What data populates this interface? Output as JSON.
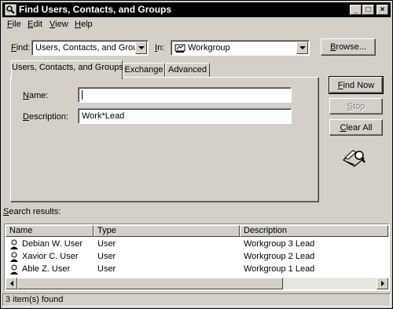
{
  "window": {
    "title": "Find Users, Contacts, and Groups",
    "icon": "find-people-icon"
  },
  "menubar": [
    {
      "label": "File",
      "accel": "F",
      "rest": "ile"
    },
    {
      "label": "Edit",
      "accel": "E",
      "rest": "dit"
    },
    {
      "label": "View",
      "accel": "V",
      "rest": "iew"
    },
    {
      "label": "Help",
      "accel": "H",
      "rest": "elp"
    }
  ],
  "find": {
    "label_accel": "F",
    "label_rest": "ind:",
    "value": "Users, Contacts, and Groups"
  },
  "in": {
    "label_accel": "I",
    "label_rest": "n:",
    "value": "Workgroup",
    "icon": "workgroup-icon"
  },
  "browse_button": {
    "accel": "B",
    "rest": "rowse..."
  },
  "tabs": [
    {
      "label": "Users, Contacts, and Groups",
      "active": true
    },
    {
      "label": "Exchange",
      "active": false
    },
    {
      "label": "Advanced",
      "active": false
    }
  ],
  "form": {
    "name_label_accel": "N",
    "name_label_rest": "ame:",
    "name_value": "",
    "description_label_accel": "D",
    "description_label_rest": "escription:",
    "description_value": "Work*Lead"
  },
  "actions": {
    "find_now": {
      "accel": "F",
      "rest": "ind Now"
    },
    "stop": {
      "accel": "S",
      "rest": "top",
      "disabled": true
    },
    "clear_all": {
      "accel": "C",
      "rest": "lear All"
    }
  },
  "results": {
    "label_accel": "S",
    "label_rest": "earch results:",
    "columns": [
      "Name",
      "Type",
      "Description"
    ],
    "rows": [
      {
        "name": "Debian W. User",
        "type": "User",
        "description": "Workgroup 3 Lead"
      },
      {
        "name": "Xavior C. User",
        "type": "User",
        "description": "Workgroup 2 Lead"
      },
      {
        "name": "Able Z. User",
        "type": "User",
        "description": "Workgroup 1 Lead"
      }
    ]
  },
  "status": "3 item(s) found"
}
